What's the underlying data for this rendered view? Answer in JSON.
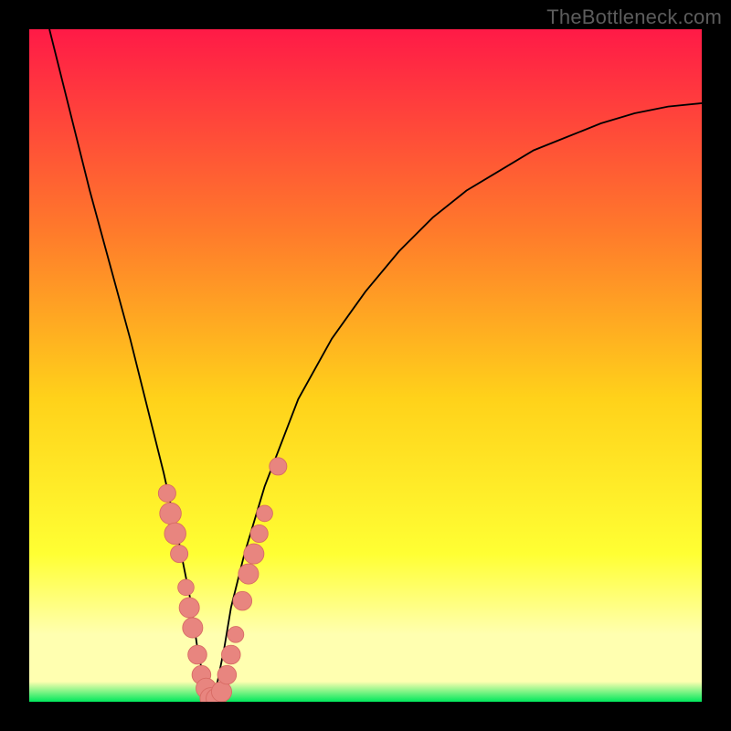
{
  "watermark": "TheBottleneck.com",
  "colors": {
    "gradient_top": "#ff1a47",
    "gradient_mid1": "#ff7a2b",
    "gradient_mid2": "#ffd21a",
    "gradient_yellow": "#ffff33",
    "gradient_pale": "#ffffb0",
    "gradient_green": "#00e85c",
    "curve": "#000000",
    "marker_fill": "#e8857f",
    "marker_stroke": "#d86b64"
  },
  "chart_data": {
    "type": "line",
    "title": "",
    "xlabel": "",
    "ylabel": "",
    "xlim": [
      0,
      100
    ],
    "ylim": [
      0,
      100
    ],
    "grid": false,
    "legend": false,
    "note": "V-shaped bottleneck curve; y visually maps to color gradient (red≈high, green≈low). Values estimated from pixel positions; no axis ticks present.",
    "series": [
      {
        "name": "bottleneck-curve",
        "x": [
          3,
          6,
          9,
          12,
          15,
          18,
          20,
          22,
          24,
          25,
          26,
          27,
          28,
          29,
          30,
          32,
          35,
          40,
          45,
          50,
          55,
          60,
          65,
          70,
          75,
          80,
          85,
          90,
          95,
          100
        ],
        "y": [
          100,
          88,
          76,
          65,
          54,
          42,
          34,
          25,
          15,
          8,
          3,
          0,
          3,
          8,
          14,
          22,
          32,
          45,
          54,
          61,
          67,
          72,
          76,
          79,
          82,
          84,
          86,
          87.5,
          88.5,
          89
        ]
      }
    ],
    "markers": [
      {
        "x": 20.5,
        "y": 31,
        "r": 1.3
      },
      {
        "x": 21.0,
        "y": 28,
        "r": 1.6
      },
      {
        "x": 21.7,
        "y": 25,
        "r": 1.6
      },
      {
        "x": 22.3,
        "y": 22,
        "r": 1.3
      },
      {
        "x": 23.3,
        "y": 17,
        "r": 1.2
      },
      {
        "x": 23.8,
        "y": 14,
        "r": 1.5
      },
      {
        "x": 24.3,
        "y": 11,
        "r": 1.5
      },
      {
        "x": 25.0,
        "y": 7,
        "r": 1.4
      },
      {
        "x": 25.6,
        "y": 4,
        "r": 1.4
      },
      {
        "x": 26.3,
        "y": 2,
        "r": 1.5
      },
      {
        "x": 27.0,
        "y": 0.5,
        "r": 1.6
      },
      {
        "x": 27.8,
        "y": 0.5,
        "r": 1.5
      },
      {
        "x": 28.6,
        "y": 1.5,
        "r": 1.5
      },
      {
        "x": 29.4,
        "y": 4,
        "r": 1.4
      },
      {
        "x": 30.0,
        "y": 7,
        "r": 1.4
      },
      {
        "x": 30.7,
        "y": 10,
        "r": 1.2
      },
      {
        "x": 31.7,
        "y": 15,
        "r": 1.4
      },
      {
        "x": 32.6,
        "y": 19,
        "r": 1.5
      },
      {
        "x": 33.4,
        "y": 22,
        "r": 1.5
      },
      {
        "x": 34.2,
        "y": 25,
        "r": 1.3
      },
      {
        "x": 35.0,
        "y": 28,
        "r": 1.2
      },
      {
        "x": 37.0,
        "y": 35,
        "r": 1.3
      }
    ]
  }
}
